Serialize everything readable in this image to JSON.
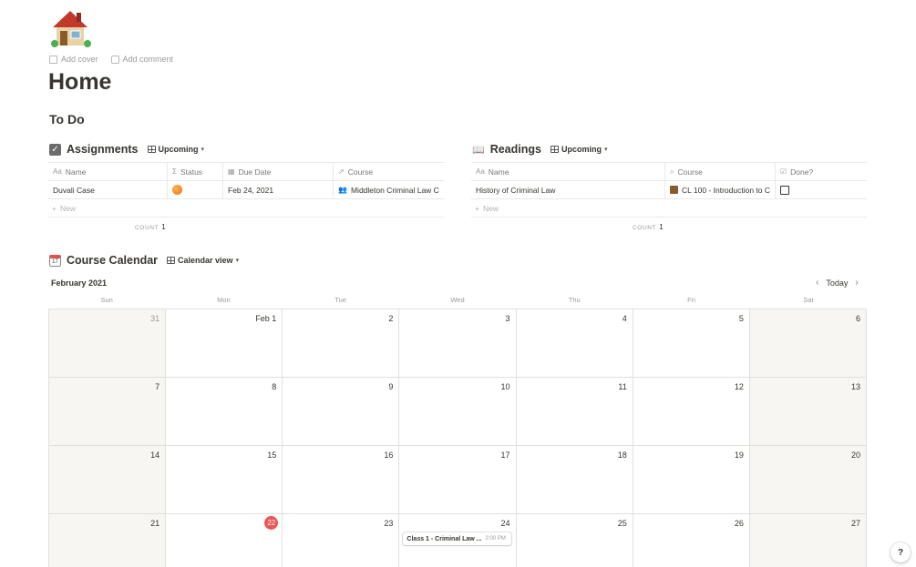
{
  "page": {
    "icon": "house-icon",
    "add_cover": "Add cover",
    "add_comment": "Add comment",
    "title": "Home",
    "section_heading": "To Do"
  },
  "assignments": {
    "title": "Assignments",
    "view": "Upcoming",
    "columns": [
      "Name",
      "Status",
      "Due Date",
      "Course"
    ],
    "rows": [
      {
        "name": "Duvali Case",
        "status": "orange-circle",
        "due": "Feb 24, 2021",
        "course": "Middleton Criminal Law C"
      }
    ],
    "new_label": "New",
    "count_label": "COUNT",
    "count": "1"
  },
  "readings": {
    "title": "Readings",
    "view": "Upcoming",
    "columns": [
      "Name",
      "Course",
      "Done?"
    ],
    "rows": [
      {
        "name": "History of Criminal Law",
        "course": "CL 100 - Introduction to C",
        "done": false
      }
    ],
    "new_label": "New",
    "count_label": "COUNT",
    "count": "1"
  },
  "calendar": {
    "title": "Course Calendar",
    "view": "Calendar view",
    "month": "February 2021",
    "today_label": "Today",
    "weekdays": [
      "Sun",
      "Mon",
      "Tue",
      "Wed",
      "Thu",
      "Fri",
      "Sat"
    ],
    "weeks": [
      [
        "31",
        "Feb 1",
        "2",
        "3",
        "4",
        "5",
        "6"
      ],
      [
        "7",
        "8",
        "9",
        "10",
        "11",
        "12",
        "13"
      ],
      [
        "14",
        "15",
        "16",
        "17",
        "18",
        "19",
        "20"
      ],
      [
        "21",
        "22",
        "23",
        "24",
        "25",
        "26",
        "27"
      ]
    ],
    "today_date": "22",
    "event": {
      "title": "Class 1 - Criminal Law ...",
      "time": "2:00 PM",
      "date": "24"
    }
  },
  "help_label": "?",
  "colors": {
    "accent_red": "#eb5757",
    "weekend_bg": "#f7f6f3",
    "text": "#37352f"
  }
}
